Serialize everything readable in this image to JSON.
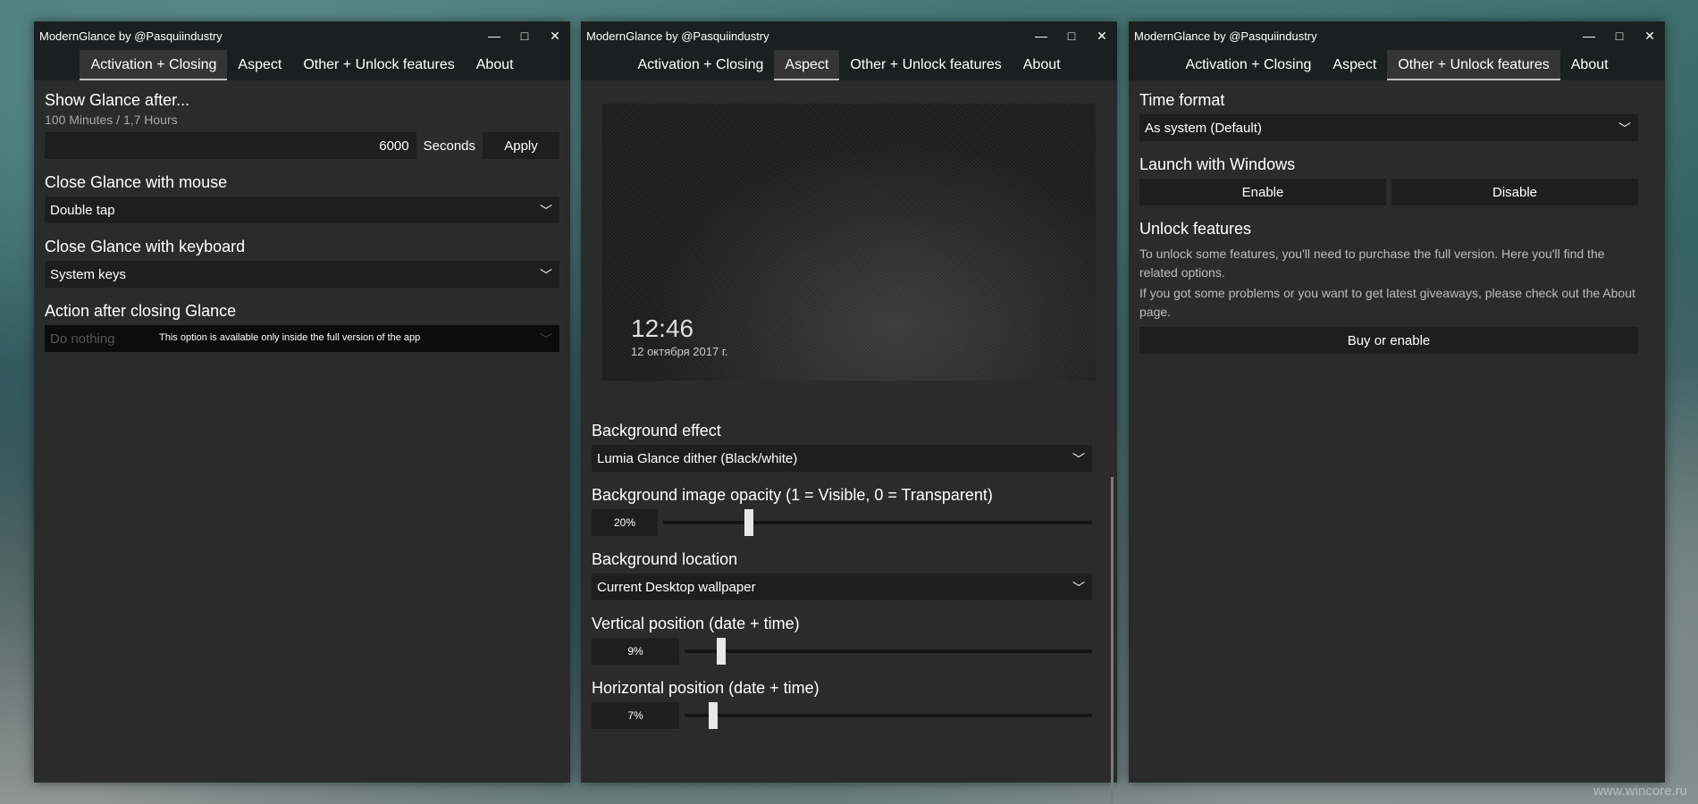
{
  "app_title": "ModernGlance by @Pasquiindustry",
  "tabs": [
    "Activation + Closing",
    "Aspect",
    "Other + Unlock features",
    "About"
  ],
  "watermark": "www.wincore.ru",
  "window1": {
    "show_after_label": "Show Glance after...",
    "show_after_sub": "100 Minutes / 1,7 Hours",
    "seconds_value": "6000",
    "seconds_unit": "Seconds",
    "apply_label": "Apply",
    "close_mouse_label": "Close Glance with mouse",
    "close_mouse_value": "Double tap",
    "close_keyboard_label": "Close Glance with keyboard",
    "close_keyboard_value": "System keys",
    "action_after_label": "Action after closing Glance",
    "action_after_value": "Do nothing",
    "action_after_notice": "This option is available only inside the full version of the app"
  },
  "window2": {
    "preview_time": "12:46",
    "preview_date": "12 октября 2017 г.",
    "bg_effect_label": "Background effect",
    "bg_effect_value": "Lumia Glance dither (Black/white)",
    "bg_opacity_label": "Background image opacity (1 = Visible, 0 = Transparent)",
    "bg_opacity_value": "20%",
    "bg_opacity_level": 0.2,
    "bg_location_label": "Background location",
    "bg_location_value": "Current Desktop wallpaper",
    "vertical_label": "Vertical position (date + time)",
    "vertical_value": "9%",
    "vertical_level": 0.09,
    "horizontal_label": "Horizontal position (date + time)",
    "horizontal_value": "7%",
    "horizontal_level": 0.07
  },
  "window3": {
    "time_format_label": "Time format",
    "time_format_value": "As system (Default)",
    "launch_label": "Launch with Windows",
    "enable_label": "Enable",
    "disable_label": "Disable",
    "unlock_label": "Unlock features",
    "unlock_text1": "To unlock some features, you'll need to purchase the full version. Here you'll find the related options.",
    "unlock_text2": "If you got some problems or you want to get latest giveaways, please check out the About page.",
    "buy_label": "Buy or enable"
  },
  "colors": {
    "window_bg": "#2b2b2b",
    "titlebar_bg": "#1c1f1f",
    "control_bg": "#1e1e1e",
    "thumb": "#e8e8e8"
  }
}
